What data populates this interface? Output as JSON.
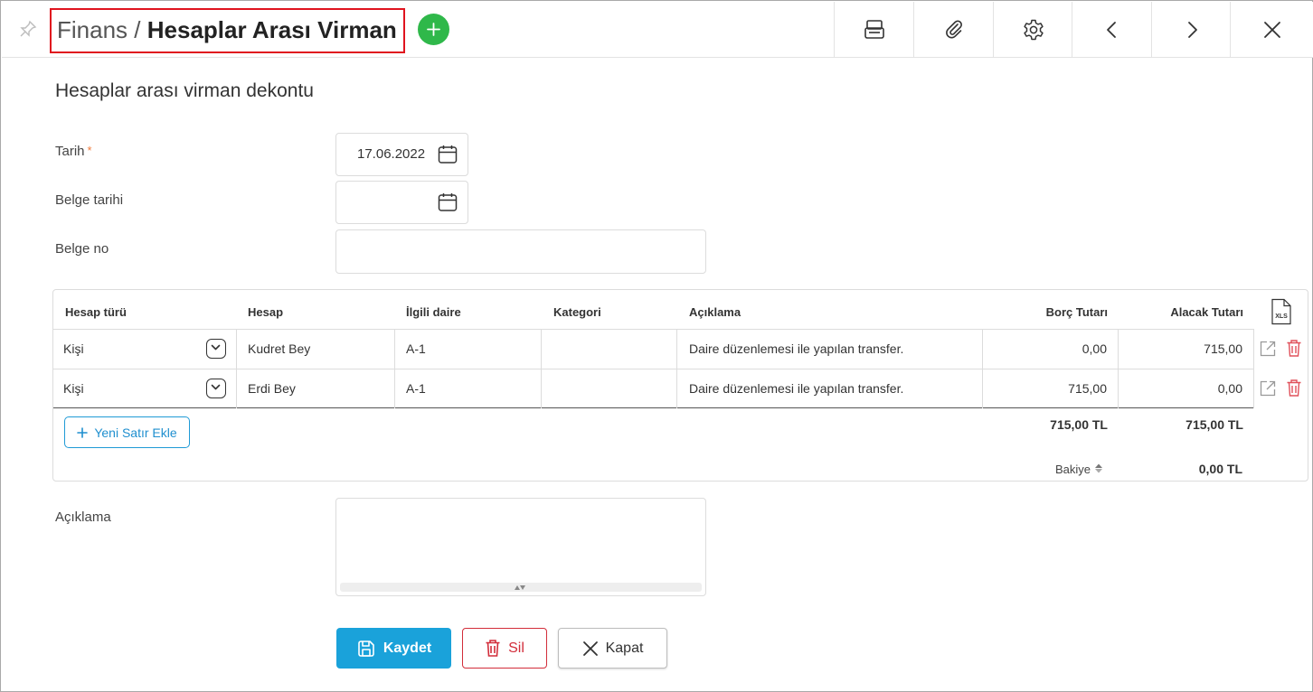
{
  "header": {
    "breadcrumb_parent": "Finans",
    "breadcrumb_separator": "/",
    "title": "Hesaplar Arası Virman",
    "toolbar_icons": [
      "print-icon",
      "attachment-icon",
      "settings-icon",
      "previous-icon",
      "next-icon",
      "close-icon"
    ]
  },
  "form": {
    "heading": "Hesaplar arası virman dekontu",
    "tarih_label": "Tarih",
    "tarih_required_mark": "*",
    "tarih_value": "17.06.2022",
    "belge_tarihi_label": "Belge tarihi",
    "belge_tarihi_value": "",
    "belge_no_label": "Belge no",
    "belge_no_value": ""
  },
  "grid": {
    "columns": {
      "hesap_turu": "Hesap türü",
      "hesap": "Hesap",
      "ilgili_daire": "İlgili daire",
      "kategori": "Kategori",
      "aciklama": "Açıklama",
      "borc": "Borç Tutarı",
      "alacak": "Alacak Tutarı",
      "export_label": "XLS"
    },
    "rows": [
      {
        "hesap_turu": "Kişi",
        "hesap": "Kudret Bey",
        "ilgili_daire": "A-1",
        "kategori": "",
        "aciklama": "Daire düzenlemesi ile yapılan transfer.",
        "borc": "0,00",
        "alacak": "715,00"
      },
      {
        "hesap_turu": "Kişi",
        "hesap": "Erdi Bey",
        "ilgili_daire": "A-1",
        "kategori": "",
        "aciklama": "Daire düzenlemesi ile yapılan transfer.",
        "borc": "715,00",
        "alacak": "0,00"
      }
    ],
    "add_row_label": "Yeni Satır Ekle",
    "total_borc": "715,00 TL",
    "total_alacak": "715,00 TL",
    "balance_label": "Bakiye",
    "balance_value": "0,00 TL"
  },
  "notes": {
    "label": "Açıklama",
    "value": ""
  },
  "actions": {
    "save_label": "Kaydet",
    "delete_label": "Sil",
    "close_label": "Kapat"
  },
  "colors": {
    "accent": "#1aa2da",
    "add_green": "#2fb84a",
    "danger": "#d22d3a",
    "highlight_border": "#e0141e",
    "required": "#f07a3c"
  }
}
